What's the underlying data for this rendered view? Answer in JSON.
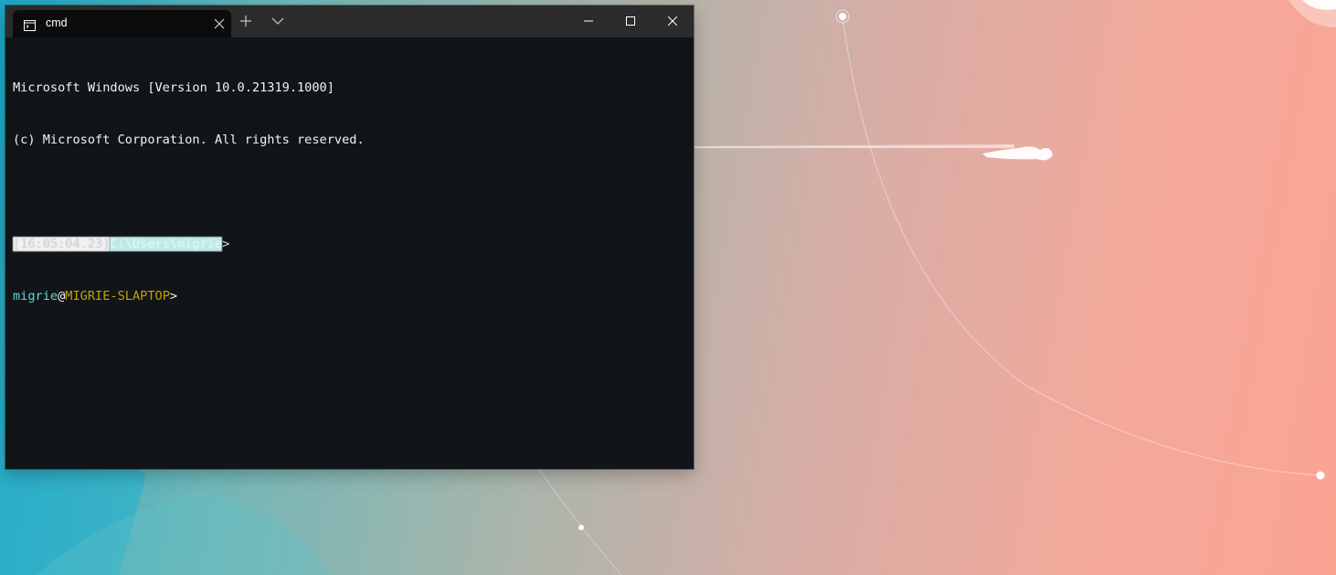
{
  "window": {
    "tab_title": "cmd",
    "icons": {
      "tab": "terminal-icon",
      "tab_close": "close-icon",
      "new_tab": "plus-icon",
      "dropdown": "chevron-down-icon",
      "minimize": "minimize-icon",
      "maximize": "maximize-icon",
      "close": "close-icon"
    }
  },
  "terminal": {
    "line1": "Microsoft Windows [Version 10.0.21319.1000]",
    "line2": "(c) Microsoft Corporation. All rights reserved.",
    "prompt1": {
      "time_segment": "[16:05:04.23]",
      "path_segment": "C:\\Users\\migrie",
      "terminator": ">"
    },
    "prompt2": {
      "user": "migrie",
      "at": "@",
      "host": "MIGRIE-SLAPTOP",
      "terminator": ">"
    }
  },
  "colors": {
    "titlebar": "#2b2b2b",
    "terminal_background": "#111418",
    "user_color": "#61d6d6",
    "host_color": "#c4a000"
  }
}
